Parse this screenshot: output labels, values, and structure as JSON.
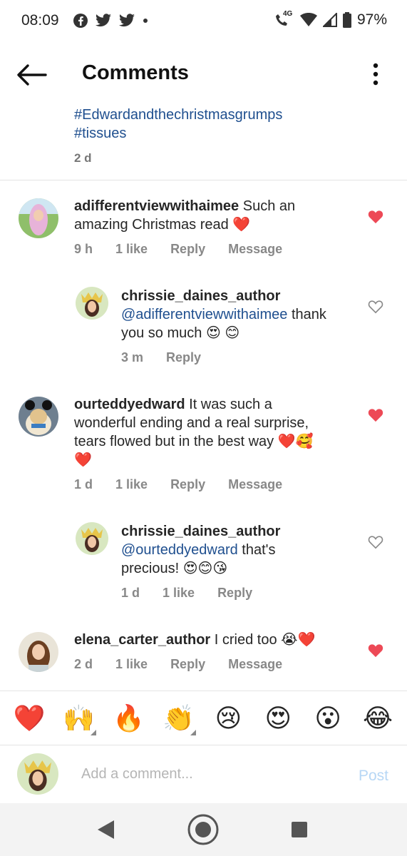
{
  "status_bar": {
    "time": "08:09",
    "network": "4G",
    "battery": "97%"
  },
  "header": {
    "title": "Comments"
  },
  "caption": {
    "line1": "#Edwardandthechristmasgrumps",
    "line2": "#tissues",
    "time": "2 d"
  },
  "comments": [
    {
      "user": "adifferentviewwithaimee",
      "text_line1": " Such an",
      "text_line2": "amazing Christmas read ❤️",
      "time": "9 h",
      "likes": "1 like",
      "reply": "Reply",
      "message": "Message",
      "liked": true
    },
    {
      "user": "chrissie_daines_author",
      "mention": "@adifferentviewwithaimee",
      "text_after_mention": " thank",
      "text_line2": "you so much 😍 😊",
      "time": "3 m",
      "reply": "Reply",
      "liked": false
    },
    {
      "user": "ourteddyedward",
      "text_line1": " It was such a",
      "text_line2": "wonderful ending and a real surprise,",
      "text_line3": "tears flowed but in the best way ❤️🥰",
      "text_line4": "❤️",
      "time": "1 d",
      "likes": "1 like",
      "reply": "Reply",
      "message": "Message",
      "liked": true
    },
    {
      "user": "chrissie_daines_author",
      "mention": "@ourteddyedward",
      "text_after_mention": " that's",
      "text_line2": "precious! 😍😊😘",
      "time": "1 d",
      "likes": "1 like",
      "reply": "Reply",
      "liked": false
    },
    {
      "user": "elena_carter_author",
      "text_line1": " I cried too 😭❤️",
      "time": "2 d",
      "likes": "1 like",
      "reply": "Reply",
      "message": "Message",
      "liked": true
    }
  ],
  "emoji_bar": [
    "❤️",
    "🙌",
    "🔥",
    "👏",
    "😢",
    "😍",
    "😮",
    "😂"
  ],
  "input": {
    "placeholder": "Add a comment...",
    "post_label": "Post"
  },
  "colors": {
    "link": "#1f4f8f",
    "heart_red": "#ed4956",
    "post_disabled": "#b7d7f5"
  }
}
